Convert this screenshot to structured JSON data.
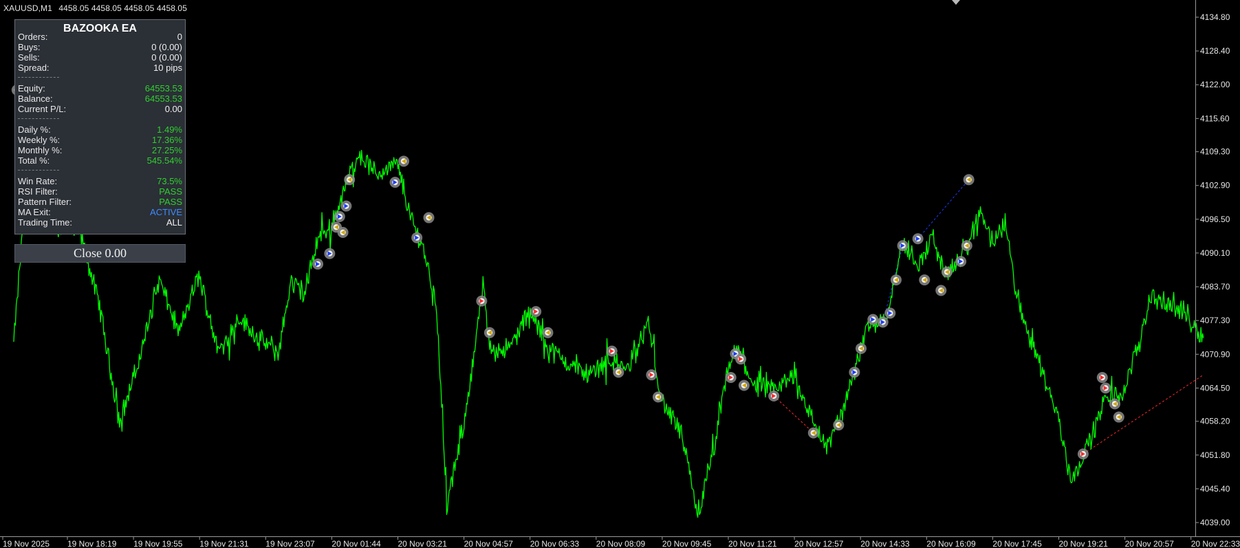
{
  "chart_header": {
    "symbol_tf": "XAUUSD,M1",
    "ohlc": "4458.05 4458.05 4458.05 4458.05"
  },
  "ea_panel": {
    "title": "BAZOOKA EA",
    "rows": [
      {
        "label": "Orders:",
        "value": "0",
        "color": "white"
      },
      {
        "label": "Buys:",
        "value": "0 (0.00)",
        "color": "white"
      },
      {
        "label": "Sells:",
        "value": "0 (0.00)",
        "color": "white"
      },
      {
        "label": "Spread:",
        "value": "10 pips",
        "color": "white"
      },
      {
        "label": "Equity:",
        "value": "64553.53",
        "color": "green"
      },
      {
        "label": "Balance:",
        "value": "64553.53",
        "color": "green"
      },
      {
        "label": "Current P/L:",
        "value": "0.00",
        "color": "white"
      },
      {
        "label": "Daily %:",
        "value": "1.49%",
        "color": "green"
      },
      {
        "label": "Weekly %:",
        "value": "17.36%",
        "color": "green"
      },
      {
        "label": "Monthly %:",
        "value": "27.25%",
        "color": "green"
      },
      {
        "label": "Total %:",
        "value": "545.54%",
        "color": "green"
      },
      {
        "label": "Win Rate:",
        "value": "73.5%",
        "color": "green"
      },
      {
        "label": "RSI Filter:",
        "value": "PASS",
        "color": "green"
      },
      {
        "label": "Pattern Filter:",
        "value": "PASS",
        "color": "green"
      },
      {
        "label": "MA Exit:",
        "value": "ACTIVE",
        "color": "blue"
      },
      {
        "label": "Trading Time:",
        "value": "ALL",
        "color": "white"
      }
    ]
  },
  "close_button": {
    "label": "Close 0.00"
  },
  "colors": {
    "background": "#000000",
    "price_line": "#00ff00",
    "text": "#e6e6e6",
    "panel_bg": "#2b2f36",
    "positive": "#2fd02f",
    "accent_blue": "#3d8cff",
    "buy_marker": "#1a3cff",
    "sell_marker": "#ff2a2a",
    "marker_bg": "#8a8a8a"
  },
  "chart_data": {
    "type": "line",
    "symbol": "XAUUSD",
    "timeframe": "M1",
    "y_ticks": [
      "4134.80",
      "4128.40",
      "4122.00",
      "4115.60",
      "4109.30",
      "4102.90",
      "4096.50",
      "4090.10",
      "4083.70",
      "4077.30",
      "4070.90",
      "4064.50",
      "4058.20",
      "4051.80",
      "4045.40",
      "4039.00"
    ],
    "ylim": [
      4038.4,
      4137.1
    ],
    "x_ticks": [
      "19 Nov 2025",
      "19 Nov 18:19",
      "19 Nov 19:55",
      "19 Nov 21:31",
      "19 Nov 23:07",
      "20 Nov 01:44",
      "20 Nov 03:21",
      "20 Nov 04:57",
      "20 Nov 06:33",
      "20 Nov 08:09",
      "20 Nov 09:45",
      "20 Nov 11:21",
      "20 Nov 12:57",
      "20 Nov 14:33",
      "20 Nov 16:09",
      "20 Nov 17:45",
      "20 Nov 19:21",
      "20 Nov 20:57",
      "20 Nov 22:33"
    ],
    "price_path": [
      [
        0,
        4073.0
      ],
      [
        0.3,
        4121.0
      ],
      [
        0.6,
        4095.0
      ],
      [
        1.0,
        4094.0
      ],
      [
        1.3,
        4080.0
      ],
      [
        1.6,
        4058.0
      ],
      [
        1.9,
        4070.0
      ],
      [
        2.2,
        4085.0
      ],
      [
        2.5,
        4075.0
      ],
      [
        2.8,
        4086.0
      ],
      [
        3.1,
        4071.0
      ],
      [
        3.4,
        4078.0
      ],
      [
        3.7,
        4074.0
      ],
      [
        4.0,
        4071.0
      ],
      [
        4.2,
        4085.0
      ],
      [
        4.4,
        4082.0
      ],
      [
        4.6,
        4093.0
      ],
      [
        4.8,
        4095.0
      ],
      [
        5.0,
        4102.0
      ],
      [
        5.2,
        4109.0
      ],
      [
        5.5,
        4105.0
      ],
      [
        5.8,
        4107.0
      ],
      [
        6.0,
        4097.0
      ],
      [
        6.2,
        4091.0
      ],
      [
        6.4,
        4080.0
      ],
      [
        6.55,
        4042.0
      ],
      [
        6.8,
        4057.0
      ],
      [
        7.0,
        4074.0
      ],
      [
        7.1,
        4084.0
      ],
      [
        7.2,
        4072.0
      ],
      [
        7.5,
        4072.0
      ],
      [
        7.8,
        4079.0
      ],
      [
        8.1,
        4072.0
      ],
      [
        8.4,
        4069.0
      ],
      [
        8.7,
        4067.0
      ],
      [
        9.0,
        4070.0
      ],
      [
        9.3,
        4068.0
      ],
      [
        9.6,
        4077.0
      ],
      [
        9.8,
        4062.0
      ],
      [
        10.1,
        4056.0
      ],
      [
        10.35,
        4040.0
      ],
      [
        10.6,
        4053.0
      ],
      [
        10.8,
        4068.0
      ],
      [
        10.95,
        4072.0
      ],
      [
        11.2,
        4065.0
      ],
      [
        11.5,
        4064.0
      ],
      [
        11.8,
        4067.0
      ],
      [
        12.1,
        4058.0
      ],
      [
        12.3,
        4053.0
      ],
      [
        12.6,
        4062.0
      ],
      [
        12.9,
        4076.0
      ],
      [
        13.2,
        4078.0
      ],
      [
        13.45,
        4092.0
      ],
      [
        13.7,
        4088.0
      ],
      [
        13.9,
        4093.0
      ],
      [
        14.1,
        4086.0
      ],
      [
        14.4,
        4090.0
      ],
      [
        14.6,
        4098.0
      ],
      [
        14.85,
        4092.0
      ],
      [
        15.0,
        4096.0
      ],
      [
        15.2,
        4080.0
      ],
      [
        15.5,
        4070.0
      ],
      [
        15.8,
        4059.0
      ],
      [
        16.0,
        4047.0
      ],
      [
        16.3,
        4055.0
      ],
      [
        16.5,
        4062.0
      ],
      [
        16.8,
        4064.0
      ],
      [
        17.0,
        4072.0
      ],
      [
        17.2,
        4082.0
      ],
      [
        17.5,
        4080.0
      ],
      [
        17.7,
        4079.0
      ],
      [
        18.0,
        4074.0
      ]
    ],
    "trade_markers": [
      [
        0.05,
        4121.0,
        "buy"
      ],
      [
        4.6,
        4088.0,
        "buy"
      ],
      [
        4.78,
        4090.0,
        "buy"
      ],
      [
        4.88,
        4095.0,
        "exit"
      ],
      [
        4.93,
        4097.0,
        "buy"
      ],
      [
        4.98,
        4094.0,
        "exit"
      ],
      [
        5.03,
        4099.0,
        "buy"
      ],
      [
        5.08,
        4104.0,
        "exit"
      ],
      [
        5.77,
        4103.5,
        "buy"
      ],
      [
        5.9,
        4107.5,
        "exit"
      ],
      [
        6.1,
        4093.0,
        "buy"
      ],
      [
        6.28,
        4096.8,
        "exit"
      ],
      [
        7.08,
        4081.0,
        "sell"
      ],
      [
        7.2,
        4075.0,
        "exit"
      ],
      [
        7.9,
        4079.0,
        "sell"
      ],
      [
        8.08,
        4075.0,
        "exit"
      ],
      [
        9.05,
        4071.5,
        "sell"
      ],
      [
        9.15,
        4067.5,
        "exit"
      ],
      [
        9.65,
        4067.0,
        "sell"
      ],
      [
        9.75,
        4062.8,
        "exit"
      ],
      [
        10.85,
        4066.5,
        "sell"
      ],
      [
        10.92,
        4071.0,
        "buy"
      ],
      [
        11.0,
        4070.0,
        "sell"
      ],
      [
        11.05,
        4065.0,
        "exit"
      ],
      [
        11.5,
        4063.0,
        "sell"
      ],
      [
        12.1,
        4056.0,
        "exit"
      ],
      [
        12.48,
        4057.5,
        "exit"
      ],
      [
        12.72,
        4067.5,
        "buy"
      ],
      [
        12.82,
        4072.0,
        "exit"
      ],
      [
        13.0,
        4077.5,
        "buy"
      ],
      [
        13.15,
        4077.0,
        "buy"
      ],
      [
        13.26,
        4078.7,
        "buy"
      ],
      [
        13.35,
        4085.0,
        "exit"
      ],
      [
        13.45,
        4091.5,
        "buy"
      ],
      [
        13.68,
        4092.8,
        "buy"
      ],
      [
        13.78,
        4085.0,
        "exit"
      ],
      [
        14.03,
        4083.0,
        "exit"
      ],
      [
        14.12,
        4086.5,
        "exit"
      ],
      [
        14.33,
        4088.5,
        "buy"
      ],
      [
        14.42,
        4091.5,
        "exit"
      ],
      [
        14.45,
        4104.0,
        "exit"
      ],
      [
        16.18,
        4052.0,
        "sell"
      ],
      [
        16.47,
        4066.5,
        "sell"
      ],
      [
        16.52,
        4064.5,
        "sell"
      ],
      [
        16.66,
        4061.5,
        "exit"
      ],
      [
        16.72,
        4059.0,
        "exit"
      ]
    ]
  }
}
